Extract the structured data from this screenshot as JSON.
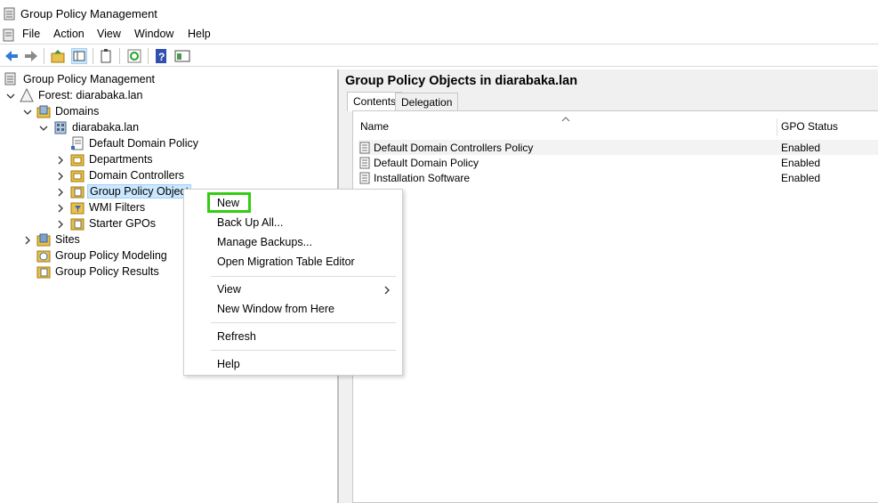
{
  "window": {
    "title": "Group Policy Management"
  },
  "menu": [
    "File",
    "Action",
    "View",
    "Window",
    "Help"
  ],
  "tree": {
    "root": "Group Policy Management",
    "forest": "Forest: diarabaka.lan",
    "domains": "Domains",
    "domain": "diarabaka.lan",
    "default_domain_policy": "Default Domain Policy",
    "departments": "Departments",
    "domain_controllers": "Domain Controllers",
    "group_policy_objects": "Group Policy Object",
    "wmi_filters": "WMI Filters",
    "starter_gpos": "Starter GPOs",
    "sites": "Sites",
    "gp_modeling": "Group Policy Modeling",
    "gp_results": "Group Policy Results"
  },
  "right_pane": {
    "header": "Group Policy Objects in diarabaka.lan",
    "tabs": [
      "Contents",
      "Delegation"
    ],
    "columns": {
      "name": "Name",
      "status": "GPO Status"
    },
    "rows": [
      {
        "name": "Default Domain Controllers Policy",
        "status": "Enabled"
      },
      {
        "name": "Default Domain Policy",
        "status": "Enabled"
      },
      {
        "name": "Installation Software",
        "status": "Enabled"
      }
    ]
  },
  "context_menu": {
    "new": "New",
    "backup_all": "Back Up All...",
    "manage_backups": "Manage Backups...",
    "open_migration": "Open Migration Table Editor",
    "view": "View",
    "new_window": "New Window from Here",
    "refresh": "Refresh",
    "help": "Help"
  },
  "colors": {
    "highlight": "#33cc11",
    "selection": "#cce8ff"
  }
}
